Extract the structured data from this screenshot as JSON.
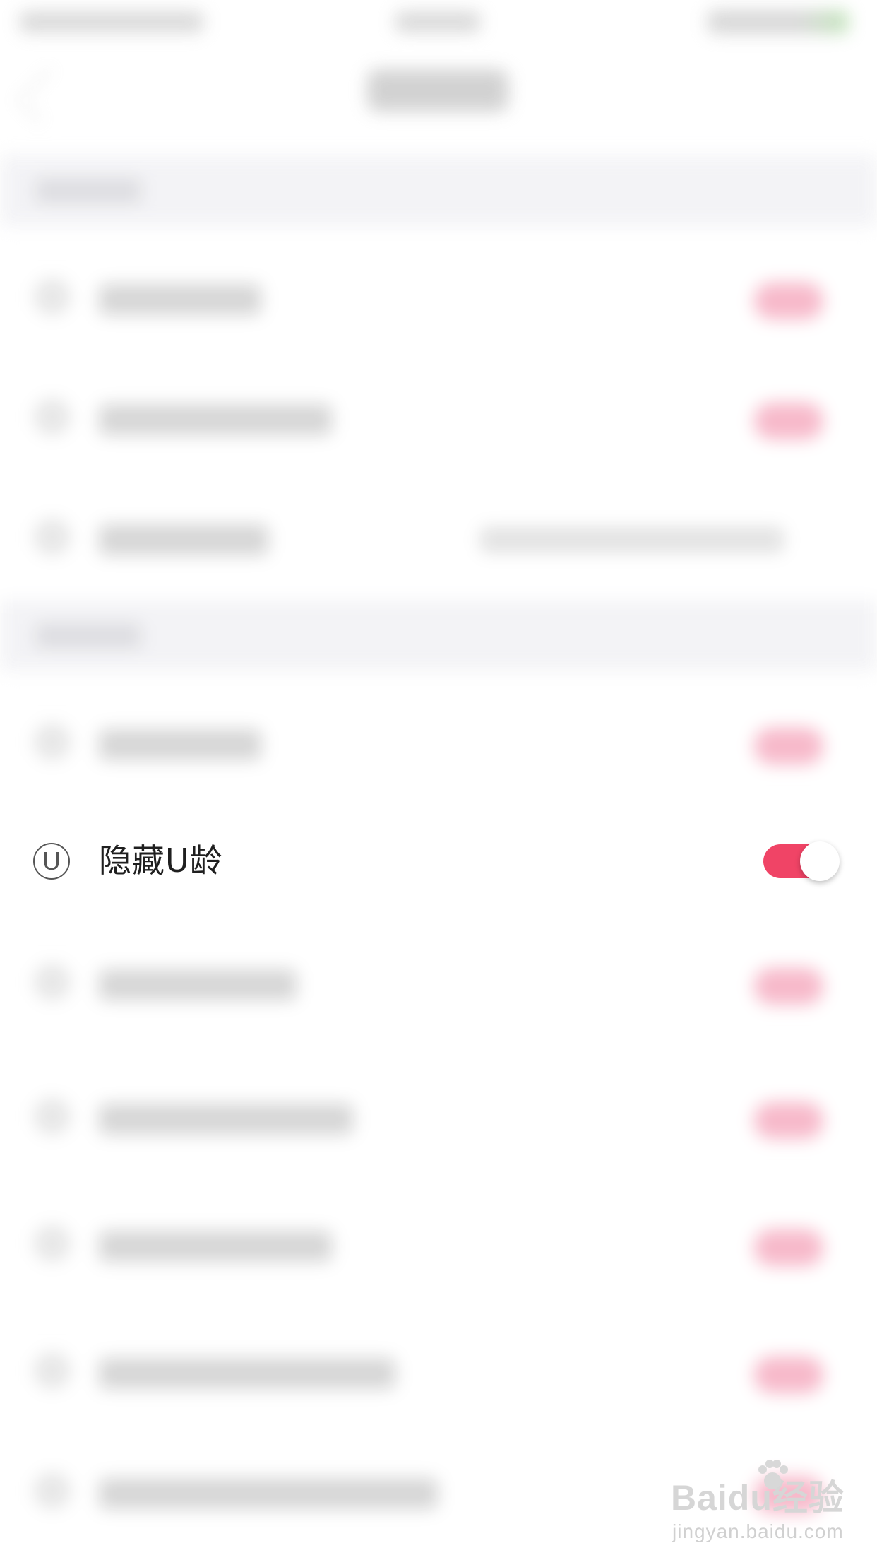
{
  "focused_setting": {
    "icon_name": "u-circle-icon",
    "icon_glyph": "U",
    "label": "隐藏U龄",
    "toggle_on": true,
    "toggle_color": "#f04466"
  },
  "watermark": {
    "brand": "Baidu经验",
    "url": "jingyan.baidu.com"
  },
  "colors": {
    "accent": "#f04466",
    "section_background": "#f3f3f6"
  }
}
